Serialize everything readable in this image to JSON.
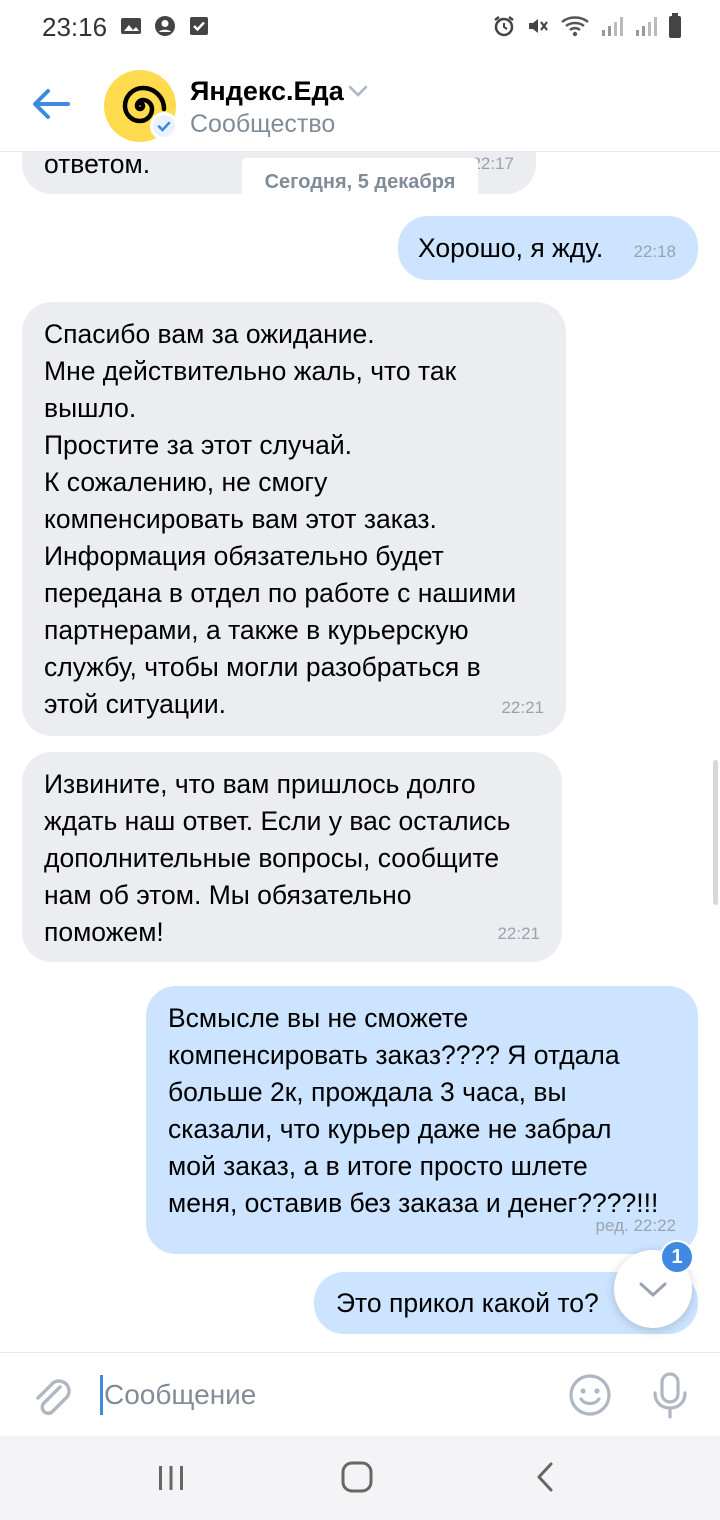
{
  "status_bar": {
    "time": "23:16"
  },
  "header": {
    "title": "Яндекс.Еда",
    "subtitle": "Сообщество"
  },
  "date_separator": "Сегодня, 5 декабря",
  "messages": [
    {
      "direction": "in",
      "text": "ответом.",
      "time": "22:17"
    },
    {
      "direction": "out",
      "text": "Хорошо, я жду.",
      "time": "22:18"
    },
    {
      "direction": "in",
      "text": "Спасибо вам за ожидание.\nМне действительно жаль, что так\nвышло.\nПростите за этот случай.\nК сожалению, не смогу\nкомпенсировать вам этот заказ.\nИнформация обязательно будет\nпередана в отдел по работе с нашими\nпартнерами, а также в курьерскую\nслужбу, чтобы могли разобраться в\nэтой ситуации.",
      "time": "22:21"
    },
    {
      "direction": "in",
      "text": "Извините, что вам пришлось долго\nждать наш ответ. Если у вас остались\nдополнительные вопросы, сообщите\nнам об этом. Мы обязательно\nпоможем!",
      "time": "22:21"
    },
    {
      "direction": "out",
      "text": "Всмысле вы не сможете\nкомпенсировать заказ???? Я отдала\nбольше 2к, прождала 3 часа, вы\nсказали, что курьер даже не забрал\nмой заказ, а в итоге просто шлете\nменя, оставив без заказа и денег????!!!",
      "time": "ред. 22:22"
    },
    {
      "direction": "out",
      "text": "Это прикол какой то?",
      "time": ""
    }
  ],
  "unread_count": "1",
  "composer": {
    "placeholder": "Сообщение"
  },
  "colors": {
    "accent": "#3f8ae0",
    "incoming_bubble": "#ebedf0",
    "outgoing_bubble": "#cce4ff",
    "brand_yellow": "#ffdb4d"
  }
}
